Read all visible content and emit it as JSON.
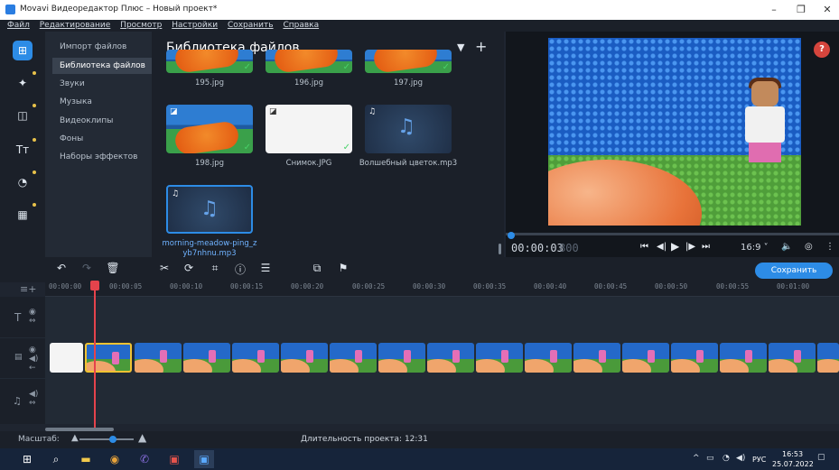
{
  "window": {
    "title": "Movavi Видеоредактор Плюс – Новый проект*",
    "minimize": "–",
    "maximize": "❐",
    "close": "✕"
  },
  "menu": [
    "Файл",
    "Редактирование",
    "Просмотр",
    "Настройки",
    "Сохранить",
    "Справка"
  ],
  "sidebar_icons": [
    "import-icon",
    "magic-wand-icon",
    "transitions-icon",
    "titles-icon",
    "stickers-icon",
    "more-tools-icon"
  ],
  "categories": [
    "Импорт файлов",
    "Библиотека файлов",
    "Звуки",
    "Музыка",
    "Видеоклипы",
    "Фоны",
    "Наборы эффектов"
  ],
  "active_category": "Библиотека файлов",
  "library": {
    "title": "Библиотека файлов",
    "filter_icon": "▼",
    "add_icon": "+",
    "files": [
      {
        "name": "195.jpg",
        "type": "image"
      },
      {
        "name": "196.jpg",
        "type": "image"
      },
      {
        "name": "197.jpg",
        "type": "image"
      },
      {
        "name": "198.jpg",
        "type": "image"
      },
      {
        "name": "Снимок.JPG",
        "type": "document"
      },
      {
        "name": "Волшебный цветок.mp3",
        "type": "audio"
      },
      {
        "name": "morning-meadow-ping_zyb7nhnu.mp3",
        "type": "audio"
      }
    ]
  },
  "player": {
    "timecode": "00:00:03",
    "frames": "800",
    "aspect": "16:9 ˅",
    "help": "?",
    "progress_fraction": 0.01
  },
  "toolbar": {
    "save_label": "Сохранить"
  },
  "ruler_ticks": [
    "00:00:00",
    "00:00:05",
    "00:00:10",
    "00:00:15",
    "00:00:20",
    "00:00:25",
    "00:00:30",
    "00:00:35",
    "00:00:40",
    "00:00:45",
    "00:00:50",
    "00:00:55",
    "00:01:00"
  ],
  "status": {
    "scale_label": "Масштаб:",
    "duration": "Длительность проекта: 12:31"
  },
  "taskbar": {
    "lang": "РУС",
    "time": "16:53",
    "date": "25.07.2022"
  },
  "colors": {
    "accent": "#2d8ce6",
    "playhead": "#e5434c",
    "background": "#1f2530"
  }
}
